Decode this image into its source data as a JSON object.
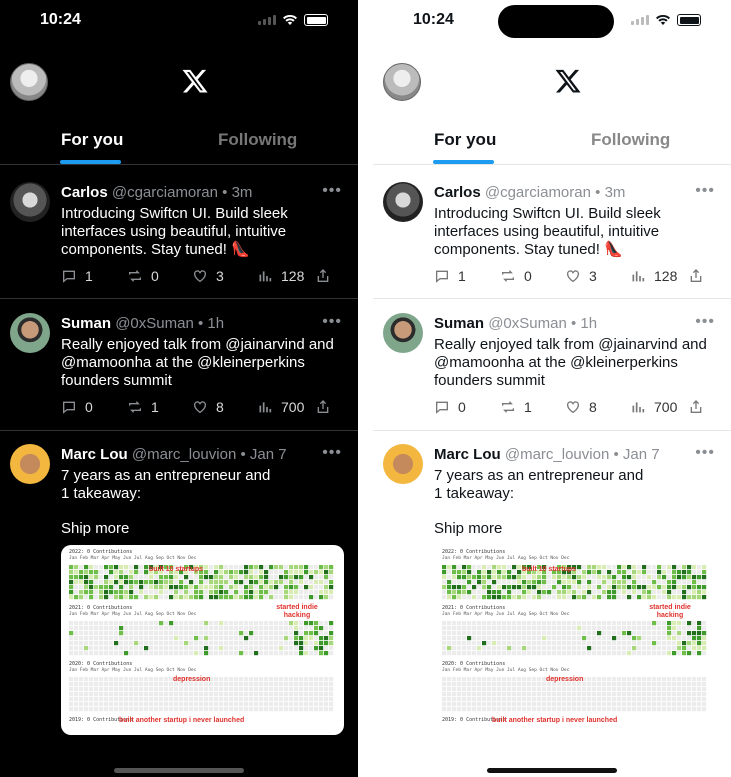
{
  "status": {
    "time": "10:24"
  },
  "tabs": {
    "for_you": "For you",
    "following": "Following"
  },
  "posts": [
    {
      "name": "Carlos",
      "handle": "@cgarciamoran",
      "dot": "•",
      "ago": "3m",
      "text": "Introducing Swiftcn UI. Build sleek interfaces using beautiful, intuitive components. Stay tuned! 👠",
      "replies": "1",
      "reposts": "0",
      "likes": "3",
      "views": "128"
    },
    {
      "name": "Suman",
      "handle": "@0xSuman",
      "dot": "•",
      "ago": "1h",
      "text": "Really enjoyed talk from @jainarvind and @mamoonha at the @kleinerperkins founders summit",
      "replies": "0",
      "reposts": "1",
      "likes": "8",
      "views": "700"
    },
    {
      "name": "Marc Lou",
      "handle": "@marc_louvion",
      "dot": "•",
      "ago": "Jan 7",
      "text": "7 years as an entrepreneur and\n1 takeaway:",
      "text2": "Ship more"
    }
  ],
  "card": {
    "sections": [
      {
        "title": "2022: 0 Contributions",
        "level": 0.7
      },
      {
        "title": "2021: 0 Contributions",
        "level": 0.08
      },
      {
        "title": "2020: 0 Contributions",
        "level": 0.0
      },
      {
        "title": "2019: 0 Contributions",
        "level": 0.0
      }
    ],
    "months": "Jan   Feb   Mar   Apr   May   Jun   Jul   Aug   Sep   Oct   Nov   Dec",
    "annotations": {
      "a1": "built 10 startups",
      "a2": "started indie hacking",
      "a3": "depression",
      "a4": "built  another startup i never launched"
    }
  },
  "icons": [
    "avatar",
    "x-logo",
    "more-icon",
    "reply-icon",
    "repost-icon",
    "like-icon",
    "views-icon",
    "share-icon"
  ],
  "colors": {
    "accent": "#1d9bf0",
    "annotation": "#e0322d"
  }
}
